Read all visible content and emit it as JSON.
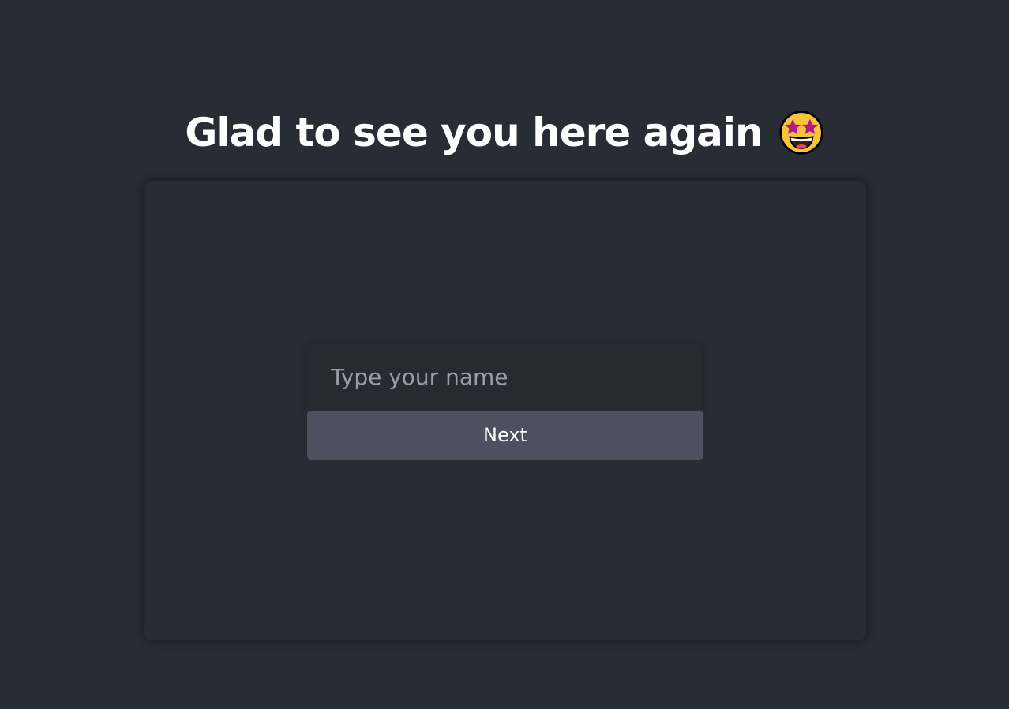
{
  "header": {
    "title": "Glad to see you here again",
    "emoji_icon": "star-struck-icon"
  },
  "form": {
    "name_placeholder": "Type your name",
    "name_value": "",
    "next_label": "Next"
  },
  "colors": {
    "background": "#282c34",
    "input_background": "#262a31",
    "button_background": "#4b515e",
    "text": "#ffffff",
    "placeholder": "#9a9ea6"
  }
}
